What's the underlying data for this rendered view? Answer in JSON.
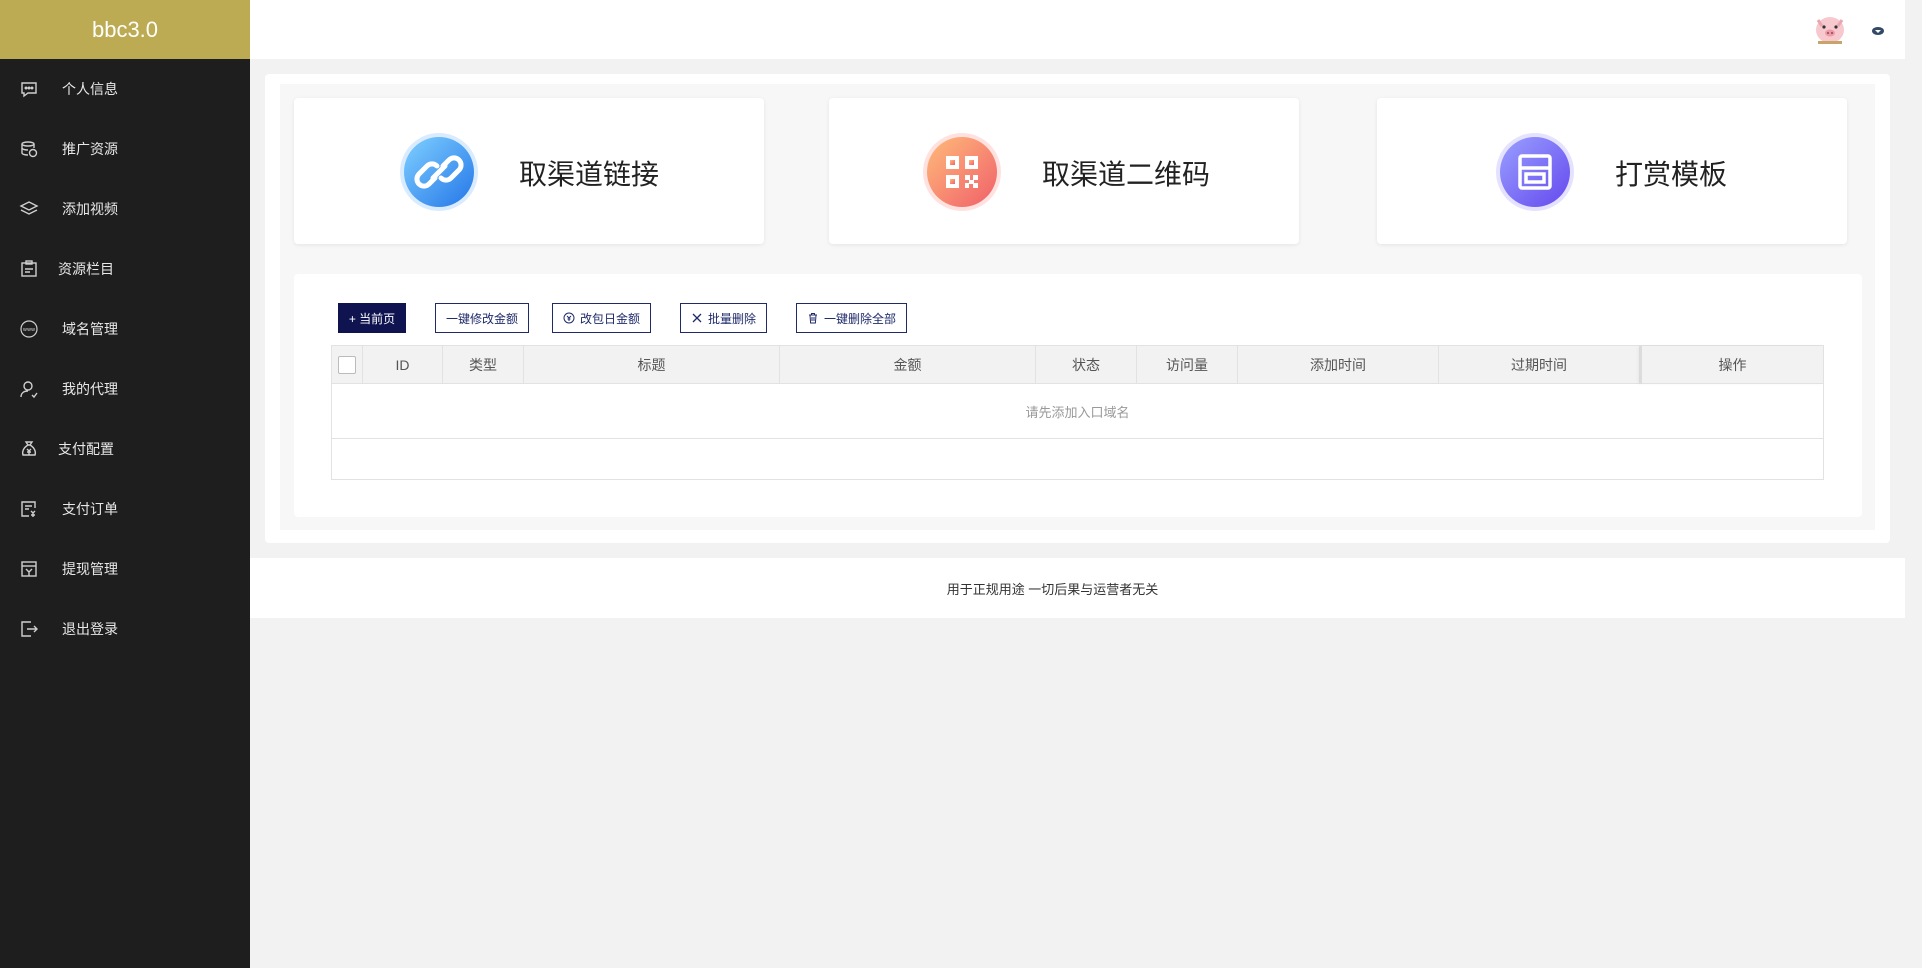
{
  "brand": {
    "title": "bbc3.0"
  },
  "sidebar": {
    "items": [
      {
        "label": "个人信息",
        "icon": "chat-bubble-icon"
      },
      {
        "label": "推广资源",
        "icon": "coins-stack-icon"
      },
      {
        "label": "添加视频",
        "icon": "layers-icon"
      },
      {
        "label": "资源栏目",
        "icon": "clipboard-icon"
      },
      {
        "label": "域名管理",
        "icon": "www-globe-icon"
      },
      {
        "label": "我的代理",
        "icon": "user-icon"
      },
      {
        "label": "支付配置",
        "icon": "money-bag-icon"
      },
      {
        "label": "支付订单",
        "icon": "receipt-yen-icon"
      },
      {
        "label": "提现管理",
        "icon": "withdraw-icon"
      },
      {
        "label": "退出登录",
        "icon": "logout-icon"
      }
    ]
  },
  "header": {
    "avatar_icon": "pig-avatar-icon",
    "menu_caret_icon": "caret-down-icon"
  },
  "cards": [
    {
      "label": "取渠道链接",
      "icon": "link-icon",
      "colors": [
        "#6ec3ff",
        "#2e86f0"
      ]
    },
    {
      "label": "取渠道二维码",
      "icon": "qrcode-icon",
      "colors": [
        "#ffb07a",
        "#f46a6a"
      ]
    },
    {
      "label": "打赏模板",
      "icon": "template-icon",
      "colors": [
        "#8d8cff",
        "#6b55f0"
      ]
    }
  ],
  "toolbar": {
    "current_page": "+ 当前页",
    "edit_amount": "一键修改金额",
    "edit_daily_amount": "改包日金额",
    "batch_delete": "批量删除",
    "delete_all": "一键删除全部"
  },
  "table": {
    "columns": [
      "ID",
      "类型",
      "标题",
      "金额",
      "状态",
      "访问量",
      "添加时间",
      "过期时间",
      "操作"
    ],
    "empty_text": "请先添加入口域名"
  },
  "footer": {
    "text": "用于正规用途 一切后果与运营者无关"
  },
  "colors": {
    "sidebar_bg": "#1e1e1e",
    "brand_bg": "#bcab52",
    "primary_btn": "#0f1450"
  }
}
